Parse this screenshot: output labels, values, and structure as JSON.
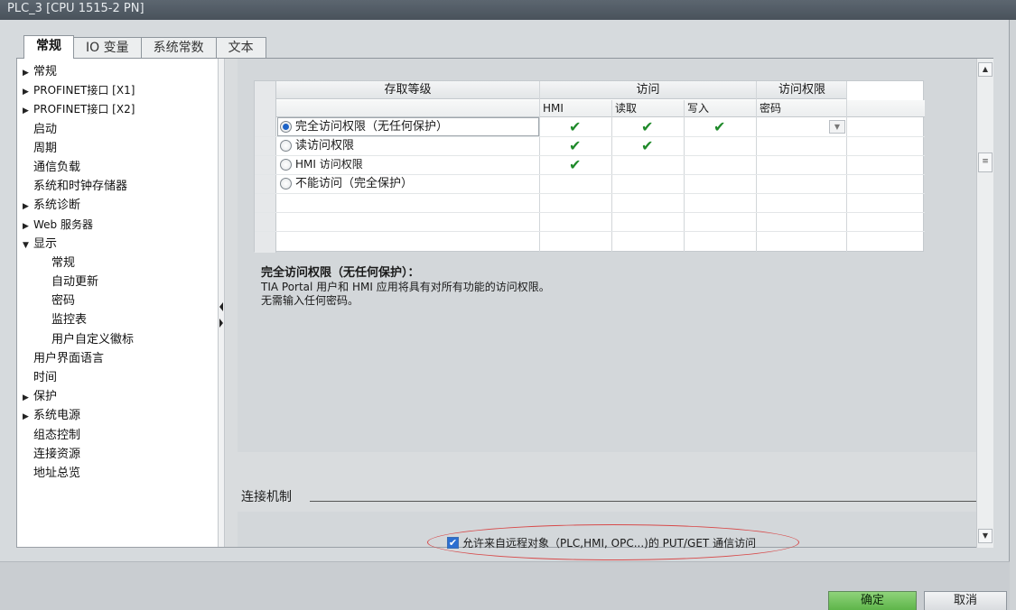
{
  "window": {
    "title": "PLC_3 [CPU 1515-2 PN]"
  },
  "tabs": [
    {
      "label": "常规",
      "active": true
    },
    {
      "label": "IO 变量"
    },
    {
      "label": "系统常数"
    },
    {
      "label": "文本"
    }
  ],
  "nav": [
    {
      "label": "常规",
      "arrow": "▶"
    },
    {
      "label": "PROFINET接口 [X1]",
      "arrow": "▶"
    },
    {
      "label": "PROFINET接口 [X2]",
      "arrow": "▶"
    },
    {
      "label": "启动"
    },
    {
      "label": "周期"
    },
    {
      "label": "通信负载"
    },
    {
      "label": "系统和时钟存储器"
    },
    {
      "label": "系统诊断",
      "arrow": "▶"
    },
    {
      "label": "Web 服务器",
      "arrow": "▶"
    },
    {
      "label": "显示",
      "arrow": "▼"
    },
    {
      "label": "常规",
      "child": true
    },
    {
      "label": "自动更新",
      "child": true
    },
    {
      "label": "密码",
      "child": true
    },
    {
      "label": "监控表",
      "child": true
    },
    {
      "label": "用户自定义徽标",
      "child": true
    },
    {
      "label": "用户界面语言"
    },
    {
      "label": "时间"
    },
    {
      "label": "保护",
      "arrow": "▶"
    },
    {
      "label": "系统电源",
      "arrow": "▶"
    },
    {
      "label": "组态控制"
    },
    {
      "label": "连接资源"
    },
    {
      "label": "地址总览"
    }
  ],
  "access_table": {
    "headers": {
      "level": "存取等级",
      "access": "访问",
      "permission": "访问权限"
    },
    "subheaders": {
      "hmi": "HMI",
      "read": "读取",
      "write": "写入",
      "password": "密码"
    },
    "rows": [
      {
        "label": "完全访问权限（无任何保护）",
        "selected": true
      },
      {
        "label": "读访问权限"
      },
      {
        "label": "HMI 访问权限"
      },
      {
        "label": "不能访问（完全保护）"
      }
    ],
    "check_glyph": "✔",
    "dropdown_glyph": "▼"
  },
  "description": {
    "title": "完全访问权限（无任何保护）：",
    "lines": [
      "TIA Portal 用户和 HMI 应用将具有对所有功能的访问权限。",
      "无需输入任何密码。"
    ]
  },
  "connection": {
    "section_label": "连接机制",
    "checkbox_label": "允许来自远程对象（PLC,HMI, OPC...)的 PUT/GET 通信访问",
    "checkbox_checked": true,
    "check_glyph": "✔",
    "highlight_color": "#d74a4a"
  },
  "scrollbar": {
    "up_glyph": "▲",
    "down_glyph": "▼",
    "thumb_glyph": "≡"
  },
  "buttons": {
    "ok": "确定",
    "cancel": "取消"
  },
  "colors": {
    "ok_button": "#6cc158",
    "check": "#1f8a2a",
    "radio_selected": "#1d63c7"
  }
}
